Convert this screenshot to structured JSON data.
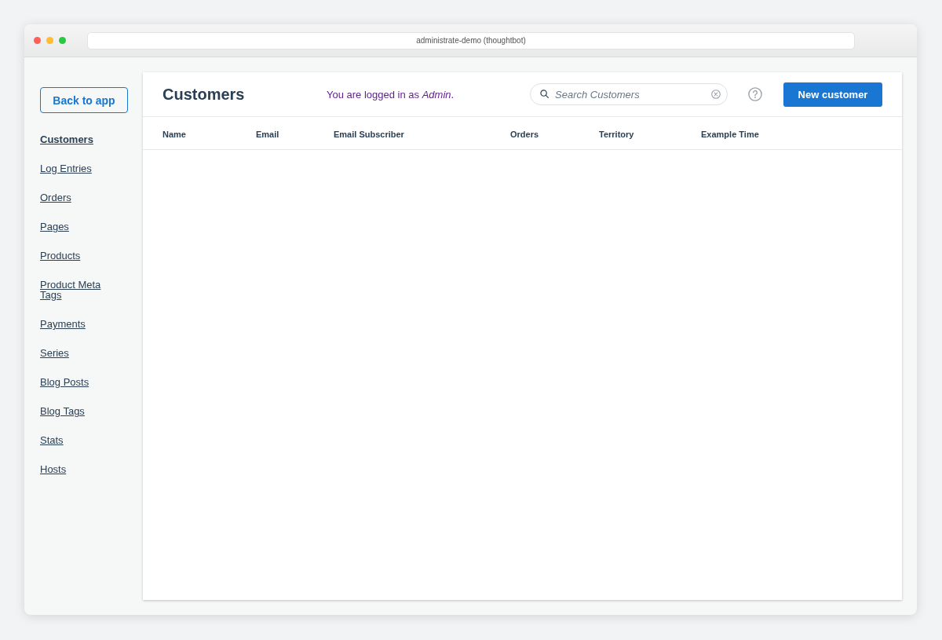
{
  "window": {
    "title": "administrate-demo (thoughtbot)"
  },
  "sidebar": {
    "back_button": "Back to app",
    "items": [
      {
        "label": "Customers",
        "selected": true
      },
      {
        "label": "Log Entries",
        "selected": false
      },
      {
        "label": "Orders",
        "selected": false
      },
      {
        "label": "Pages",
        "selected": false
      },
      {
        "label": "Products",
        "selected": false
      },
      {
        "label": "Product Meta Tags",
        "selected": false
      },
      {
        "label": "Payments",
        "selected": false
      },
      {
        "label": "Series",
        "selected": false
      },
      {
        "label": "Blog Posts",
        "selected": false
      },
      {
        "label": "Blog Tags",
        "selected": false
      },
      {
        "label": "Stats",
        "selected": false
      },
      {
        "label": "Hosts",
        "selected": false
      }
    ]
  },
  "header": {
    "title": "Customers",
    "login_notice": "You are logged in as *Admin*.",
    "search": {
      "placeholder": "Search Customers"
    },
    "new_button": "New customer"
  },
  "table": {
    "columns": [
      "Name",
      "Email",
      "Email Subscriber",
      "Orders",
      "Territory",
      "Example Time"
    ]
  }
}
